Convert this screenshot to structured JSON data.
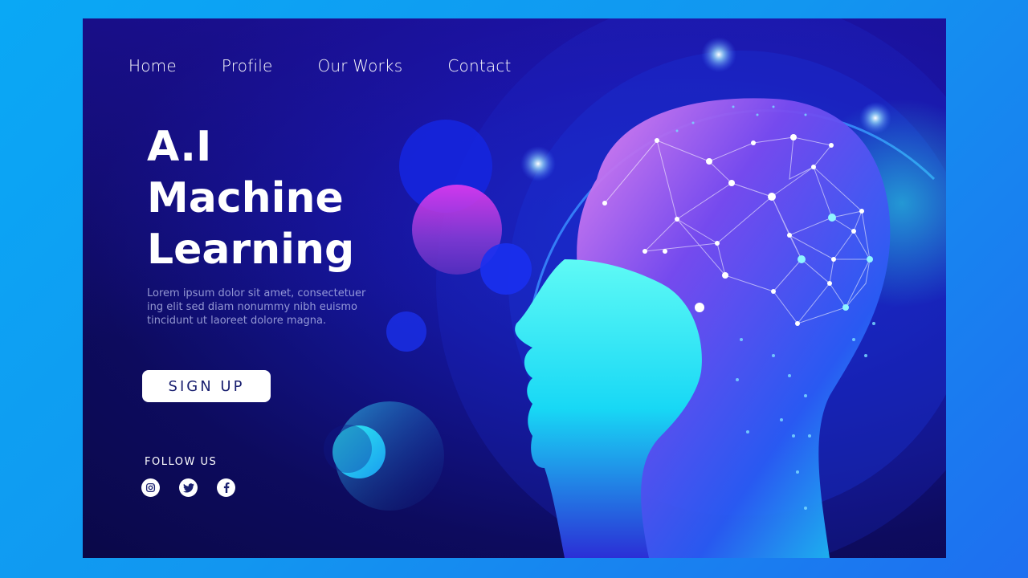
{
  "nav": {
    "items": [
      {
        "label": "Home"
      },
      {
        "label": "Profile"
      },
      {
        "label": "Our Works"
      },
      {
        "label": "Contact"
      }
    ]
  },
  "hero": {
    "title_line1": "A.I",
    "title_line2": "Machine",
    "title_line3": "Learning",
    "description": "Lorem ipsum dolor sit amet, consectetuer ing elit sed diam nonummy nibh euismo tincidunt ut laoreet dolore magna.",
    "cta_label": "SIGN UP"
  },
  "follow": {
    "label": "FOLLOW US",
    "icons": [
      "instagram-icon",
      "twitter-icon",
      "facebook-icon"
    ]
  },
  "colors": {
    "page_background": "#0aa8f5",
    "panel_dark": "#0d0b5e",
    "accent_cyan": "#22e6f2",
    "accent_magenta": "#d43cf0",
    "button_text": "#1a2070"
  }
}
